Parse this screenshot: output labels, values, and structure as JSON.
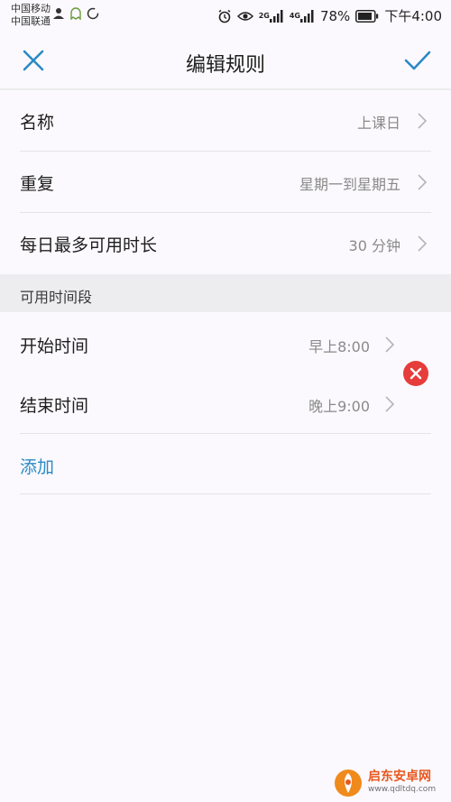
{
  "status_bar": {
    "carrier_1": "中国移动",
    "carrier_2": "中国联通",
    "network_1": "2G",
    "network_2": "4G",
    "battery": "78%",
    "time": "下午4:00",
    "icons": [
      "user-icon",
      "ghost-icon",
      "sync-icon",
      "alarm-icon",
      "eye-icon",
      "signal-icon",
      "battery-icon"
    ]
  },
  "header": {
    "title": "编辑规则",
    "close_icon": "close-icon",
    "confirm_icon": "check-icon"
  },
  "rows": [
    {
      "label": "名称",
      "value": "上课日"
    },
    {
      "label": "重复",
      "value": "星期一到星期五"
    },
    {
      "label": "每日最多可用时长",
      "value": "30 分钟"
    }
  ],
  "section": {
    "title": "可用时间段"
  },
  "time_rows": [
    {
      "label": "开始时间",
      "value": "早上8:00"
    },
    {
      "label": "结束时间",
      "value": "晚上9:00"
    }
  ],
  "add_label": "添加",
  "colors": {
    "accent": "#2a8ac6",
    "delete": "#e63d3a",
    "background": "#fbf9fd",
    "section_bg": "#ededef"
  },
  "watermark": {
    "name": "启东安卓网",
    "url": "www.qdltdq.com"
  }
}
